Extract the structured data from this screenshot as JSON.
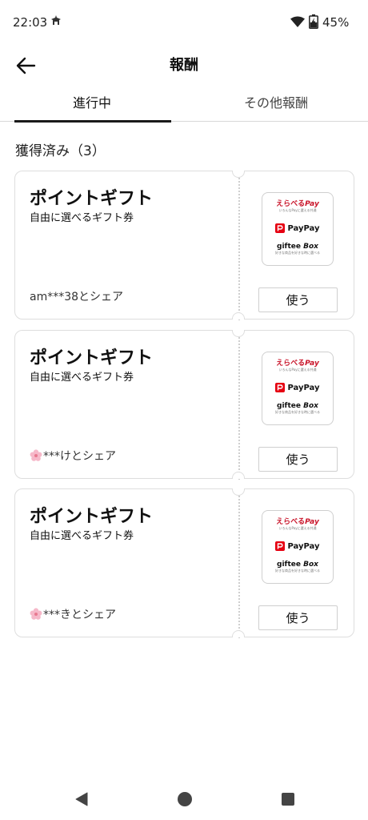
{
  "status_bar": {
    "time": "22:03",
    "battery": "45%",
    "icons": [
      "status-app-icon",
      "wifi-icon",
      "battery-charging-icon"
    ]
  },
  "header": {
    "title": "報酬",
    "back_icon": "arrow-left-icon"
  },
  "tabs": [
    {
      "label": "進行中",
      "active": true
    },
    {
      "label": "その他報酬",
      "active": false
    }
  ],
  "section": {
    "heading": "獲得済み（3）"
  },
  "rewards": [
    {
      "title": "ポイントギフト",
      "subtitle": "自由に選べるギフト券",
      "shared_with": "am***38とシェア",
      "flower_icon": false,
      "button_label": "使う"
    },
    {
      "title": "ポイントギフト",
      "subtitle": "自由に選べるギフト券",
      "shared_with": "***けとシェア",
      "flower_icon": true,
      "button_label": "使う"
    },
    {
      "title": "ポイントギフト",
      "subtitle": "自由に選べるギフト券",
      "shared_with": "***きとシェア",
      "flower_icon": true,
      "button_label": "使う"
    }
  ],
  "brands": {
    "erabel_name": "えらべる",
    "erabel_pay": "Pay",
    "erabel_tag": "いろんなPayに選える共通",
    "paypay": "PayPay",
    "giftee_name": "giftee",
    "giftee_box": "Box",
    "giftee_tag": "好きな商品を好きな時に選べる"
  },
  "colors": {
    "accent": "#1a1a1a",
    "erabel_red": "#c9152a",
    "paypay_red": "#e60012"
  },
  "nav_bar": {
    "icons": [
      "nav-back-icon",
      "nav-home-icon",
      "nav-recents-icon"
    ]
  }
}
